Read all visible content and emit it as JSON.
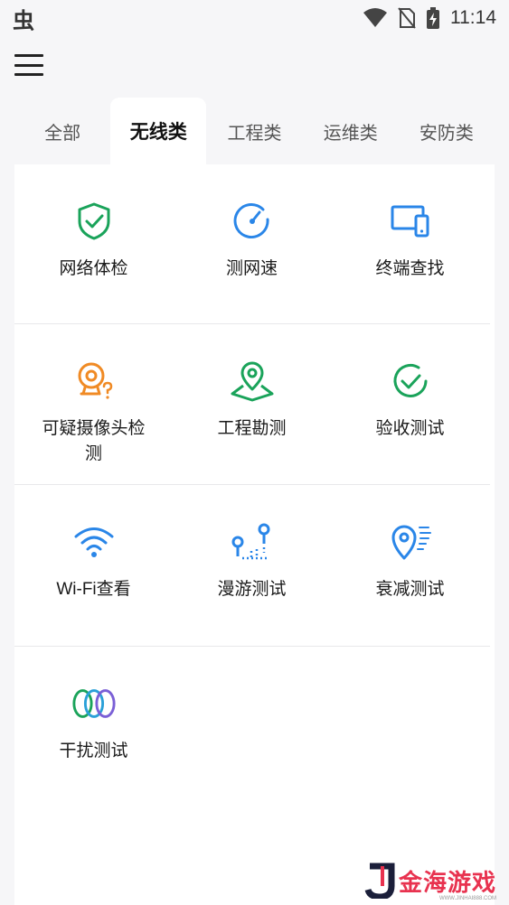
{
  "status_bar": {
    "app_glyph": "虫",
    "time": "11:14",
    "icons": [
      "wifi-icon",
      "no-sim-icon",
      "battery-charging-icon"
    ]
  },
  "toolbar": {
    "menu_icon": "hamburger-menu-icon"
  },
  "tabs": [
    {
      "label": "全部",
      "active": false
    },
    {
      "label": "无线类",
      "active": true
    },
    {
      "label": "工程类",
      "active": false
    },
    {
      "label": "运维类",
      "active": false
    },
    {
      "label": "安防类",
      "active": false
    }
  ],
  "tools": {
    "row1": [
      {
        "label": "网络体检",
        "icon": "shield-check-icon",
        "color": "#1aa35a"
      },
      {
        "label": "测网速",
        "icon": "speedometer-icon",
        "color": "#2a86e8"
      },
      {
        "label": "终端查找",
        "icon": "devices-icon",
        "color": "#2a86e8"
      }
    ],
    "row2": [
      {
        "label": "可疑摄像头检测",
        "icon": "camera-question-icon",
        "color": "#f08a24"
      },
      {
        "label": "工程勘测",
        "icon": "map-pin-icon",
        "color": "#1aa35a"
      },
      {
        "label": "验收测试",
        "icon": "check-circle-icon",
        "color": "#1aa35a"
      }
    ],
    "row3": [
      {
        "label": "Wi-Fi查看",
        "icon": "wifi-icon",
        "color": "#2a86e8"
      },
      {
        "label": "漫游测试",
        "icon": "roaming-icon",
        "color": "#2a86e8"
      },
      {
        "label": "衰减测试",
        "icon": "signal-pin-icon",
        "color": "#2a86e8"
      }
    ],
    "row4": [
      {
        "label": "干扰测试",
        "icon": "rings-icon",
        "color": "#7a5fd6"
      }
    ]
  },
  "watermark": {
    "text": "金海游戏",
    "sub": "WWW.JINHAI888.COM"
  }
}
